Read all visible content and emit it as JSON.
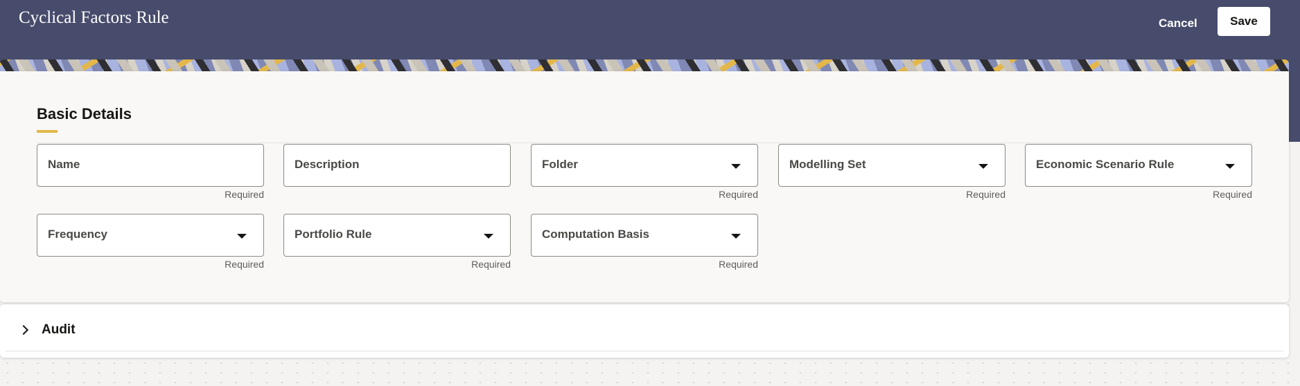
{
  "header": {
    "title": "Cyclical Factors Rule",
    "cancel_label": "Cancel",
    "save_label": "Save"
  },
  "basic_details": {
    "title": "Basic Details",
    "fields": [
      {
        "label": "Name",
        "type": "text",
        "helper": "Required"
      },
      {
        "label": "Description",
        "type": "text",
        "helper": ""
      },
      {
        "label": "Folder",
        "type": "select",
        "helper": "Required"
      },
      {
        "label": "Modelling Set",
        "type": "select",
        "helper": "Required"
      },
      {
        "label": "Economic Scenario Rule",
        "type": "select",
        "helper": "Required"
      },
      {
        "label": "Frequency",
        "type": "select",
        "helper": "Required"
      },
      {
        "label": "Portfolio Rule",
        "type": "select",
        "helper": "Required"
      },
      {
        "label": "Computation Basis",
        "type": "select",
        "helper": "Required"
      }
    ]
  },
  "audit": {
    "label": "Audit",
    "icon": "chevron-right-icon"
  },
  "colors": {
    "header_bg": "#474c6c",
    "accent": "#e3b74a",
    "card_bg": "#f9f8f6"
  }
}
